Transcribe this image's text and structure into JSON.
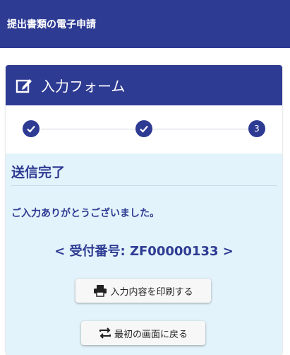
{
  "header": {
    "title": "提出書類の電子申請"
  },
  "form": {
    "title": "入力フォーム",
    "icon": "edit-form-icon",
    "steps": [
      {
        "state": "done",
        "icon": "check-icon"
      },
      {
        "state": "done",
        "icon": "check-icon"
      },
      {
        "state": "current",
        "label": "3"
      }
    ]
  },
  "result": {
    "heading": "送信完了",
    "message": "ご入力ありがとうございました。",
    "receipt_display": "< 受付番号: ZF00000133 >",
    "receipt_number": "ZF00000133"
  },
  "buttons": {
    "print_label": "入力内容を印刷する",
    "print_icon": "printer-icon",
    "restart_label": "最初の画面に戻る",
    "restart_icon": "repeat-icon"
  },
  "colors": {
    "primary": "#2e3b93",
    "panel_bg": "#e3f3fb"
  }
}
